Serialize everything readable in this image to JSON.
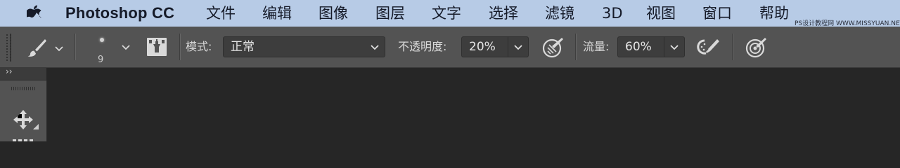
{
  "menubar": {
    "apple_icon": "apple-logo-icon",
    "app_name": "Photoshop CC",
    "items": [
      "文件",
      "编辑",
      "图像",
      "图层",
      "文字",
      "选择",
      "滤镜",
      "3D",
      "视图",
      "窗口",
      "帮助"
    ],
    "watermark": "PS设计教程网  WWW.MISSYUAN.NET"
  },
  "options": {
    "tool_icon": "brush-icon",
    "brush_size": "9",
    "toggle_panel_icon": "brush-panel-toggle-icon",
    "mode_label": "模式:",
    "mode_value": "正常",
    "opacity_label": "不透明度:",
    "opacity_value": "20%",
    "opacity_pressure_icon": "pressure-opacity-icon",
    "flow_label": "流量:",
    "flow_value": "60%",
    "airbrush_icon": "airbrush-icon",
    "pressure_size_icon": "pressure-size-icon"
  },
  "toolbar": {
    "expand_label": "››",
    "move_tool_icon": "move-tool-icon"
  },
  "colors": {
    "menubar_bg": "#b7cbe6",
    "options_bg": "#535353",
    "canvas_bg": "#262626"
  }
}
